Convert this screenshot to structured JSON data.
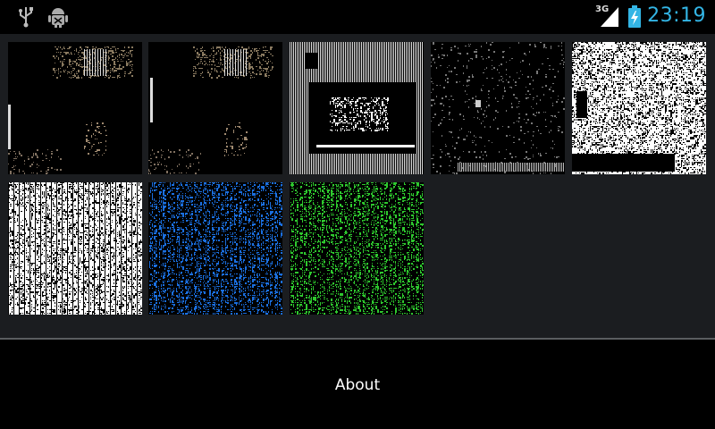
{
  "status_bar": {
    "network_label": "3G",
    "time": "23:19",
    "icons": [
      "usb-icon",
      "android-debug-icon",
      "signal-3g-icon",
      "battery-charging-icon"
    ],
    "accent_color": "#33b5e5"
  },
  "gallery": {
    "items": [
      {
        "name": "thumbnail-1",
        "style": "dark-photo-dither"
      },
      {
        "name": "thumbnail-2",
        "style": "dark-photo-dither"
      },
      {
        "name": "thumbnail-3",
        "style": "mono-stripes-frame"
      },
      {
        "name": "thumbnail-4",
        "style": "dark-sparse-dither"
      },
      {
        "name": "thumbnail-5",
        "style": "white-dense-dither"
      },
      {
        "name": "thumbnail-6",
        "style": "white-noise-dither"
      },
      {
        "name": "thumbnail-7",
        "style": "blue-noise-dither",
        "color": "#1a6fe0"
      },
      {
        "name": "thumbnail-8",
        "style": "green-noise-dither",
        "color": "#2ec82e"
      }
    ]
  },
  "footer": {
    "about_label": "About"
  },
  "colors": {
    "content_bg": "#1b1d20",
    "divider": "#5a5d60",
    "bar_bg": "#000000"
  }
}
